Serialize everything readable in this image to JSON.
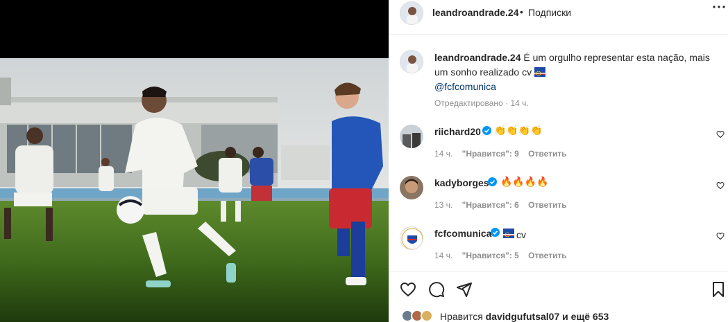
{
  "post": {
    "author": "leandroandrade.24",
    "separator": "•",
    "follow_label": "Подписки",
    "more_icon": "more-options-icon",
    "caption_text": "É um orgulho representar esta nação, mais um sonho realizado cv",
    "caption_flag_icon": "cape-verde-flag-emoji",
    "caption_mention": "@fcfcomunica",
    "edited_label": "Отредактировано",
    "edited_time": "14 ч."
  },
  "comments": [
    {
      "username": "riichard20",
      "verified": true,
      "text": "👏👏👏👏",
      "time": "14 ч.",
      "likes_label": "\"Нравится\": 9",
      "reply_label": "Ответить"
    },
    {
      "username": "kadyborges",
      "verified": true,
      "text": "🔥🔥🔥🔥",
      "time": "13 ч.",
      "likes_label": "\"Нравится\": 6",
      "reply_label": "Ответить"
    },
    {
      "username": "fcfcomunica",
      "verified": true,
      "text": "cv",
      "time": "14 ч.",
      "likes_label": "\"Нравится\": 5",
      "reply_label": "Ответить"
    }
  ],
  "likes": {
    "prefix": "Нравится",
    "user": "davidgufutsal07",
    "suffix": "и ещё 653"
  },
  "colors": {
    "text": "#262626",
    "muted": "#8e8e8e",
    "link": "#00376b",
    "verified": "#0095f6",
    "border": "#efefef"
  }
}
